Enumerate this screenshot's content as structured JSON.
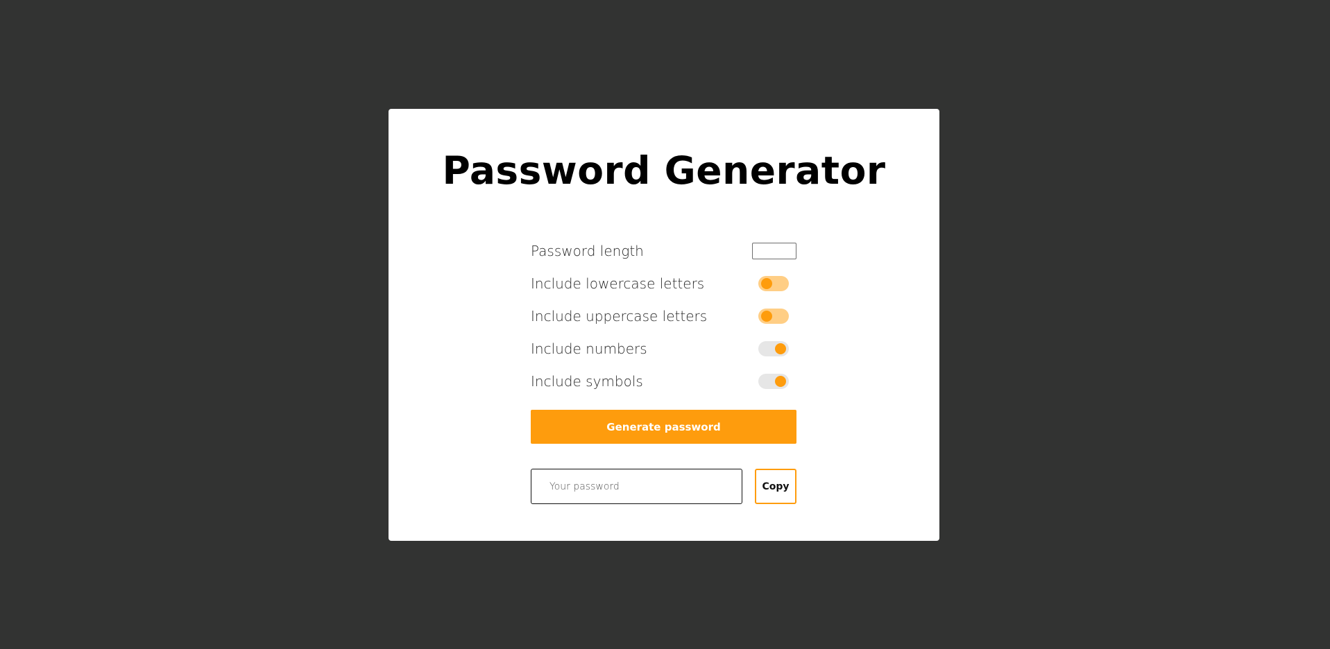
{
  "title": "Password Generator",
  "settings": {
    "length": {
      "label": "Password length",
      "value": ""
    },
    "options": [
      {
        "label": "Include lowercase letters",
        "state": "on"
      },
      {
        "label": "Include uppercase letters",
        "state": "on"
      },
      {
        "label": "Include numbers",
        "state": "off"
      },
      {
        "label": "Include symbols",
        "state": "off"
      }
    ]
  },
  "generate": {
    "label": "Generate password"
  },
  "output": {
    "placeholder": "Your password",
    "value": ""
  },
  "copy": {
    "label": "Copy"
  },
  "colors": {
    "background": "#323332",
    "card": "#ffffff",
    "accent": "#fe9c0d",
    "toggle_on_track": "#ffce85",
    "toggle_off_track": "#e6e6e6"
  }
}
